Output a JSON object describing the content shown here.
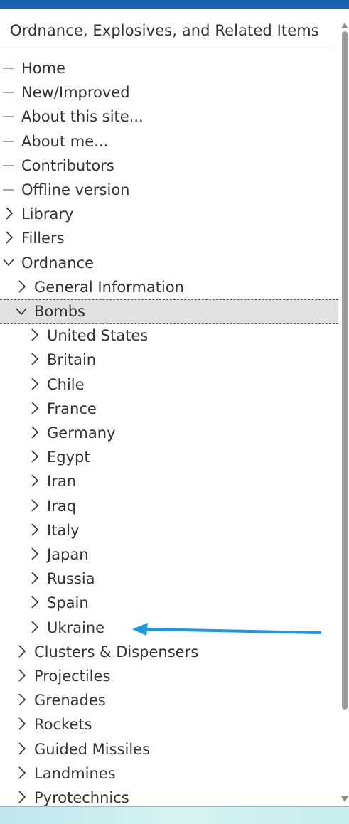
{
  "panel": {
    "title": "Ordnance, Explosives, and Related Items"
  },
  "tree": [
    {
      "label": "Home",
      "kind": "leaf",
      "depth": 0
    },
    {
      "label": "New/Improved",
      "kind": "leaf",
      "depth": 0
    },
    {
      "label": "About this site...",
      "kind": "leaf",
      "depth": 0
    },
    {
      "label": "About me...",
      "kind": "leaf",
      "depth": 0
    },
    {
      "label": "Contributors",
      "kind": "leaf",
      "depth": 0
    },
    {
      "label": "Offline version",
      "kind": "leaf",
      "depth": 0
    },
    {
      "label": "Library",
      "kind": "collapsed",
      "depth": 0
    },
    {
      "label": "Fillers",
      "kind": "collapsed",
      "depth": 0
    },
    {
      "label": "Ordnance",
      "kind": "expanded",
      "depth": 0
    },
    {
      "label": "General Information",
      "kind": "collapsed",
      "depth": 1
    },
    {
      "label": "Bombs",
      "kind": "expanded",
      "depth": 1,
      "selected": true
    },
    {
      "label": "United States",
      "kind": "collapsed",
      "depth": 2
    },
    {
      "label": "Britain",
      "kind": "collapsed",
      "depth": 2
    },
    {
      "label": "Chile",
      "kind": "collapsed",
      "depth": 2
    },
    {
      "label": "France",
      "kind": "collapsed",
      "depth": 2
    },
    {
      "label": "Germany",
      "kind": "collapsed",
      "depth": 2
    },
    {
      "label": "Egypt",
      "kind": "collapsed",
      "depth": 2
    },
    {
      "label": "Iran",
      "kind": "collapsed",
      "depth": 2
    },
    {
      "label": "Iraq",
      "kind": "collapsed",
      "depth": 2
    },
    {
      "label": "Italy",
      "kind": "collapsed",
      "depth": 2
    },
    {
      "label": "Japan",
      "kind": "collapsed",
      "depth": 2
    },
    {
      "label": "Russia",
      "kind": "collapsed",
      "depth": 2
    },
    {
      "label": "Spain",
      "kind": "collapsed",
      "depth": 2
    },
    {
      "label": "Ukraine",
      "kind": "collapsed",
      "depth": 2
    },
    {
      "label": "Clusters & Dispensers",
      "kind": "collapsed",
      "depth": 1
    },
    {
      "label": "Projectiles",
      "kind": "collapsed",
      "depth": 1
    },
    {
      "label": "Grenades",
      "kind": "collapsed",
      "depth": 1
    },
    {
      "label": "Rockets",
      "kind": "collapsed",
      "depth": 1
    },
    {
      "label": "Guided Missiles",
      "kind": "collapsed",
      "depth": 1
    },
    {
      "label": "Landmines",
      "kind": "collapsed",
      "depth": 1
    },
    {
      "label": "Pyrotechnics",
      "kind": "collapsed",
      "depth": 1
    }
  ],
  "annotation": {
    "icon": "arrow-left-icon",
    "color": "#2196e0",
    "points_to": "Ukraine"
  },
  "colors": {
    "topbar": "#1a62ad",
    "selected_row": "#e1e1e1",
    "text": "#333333"
  }
}
